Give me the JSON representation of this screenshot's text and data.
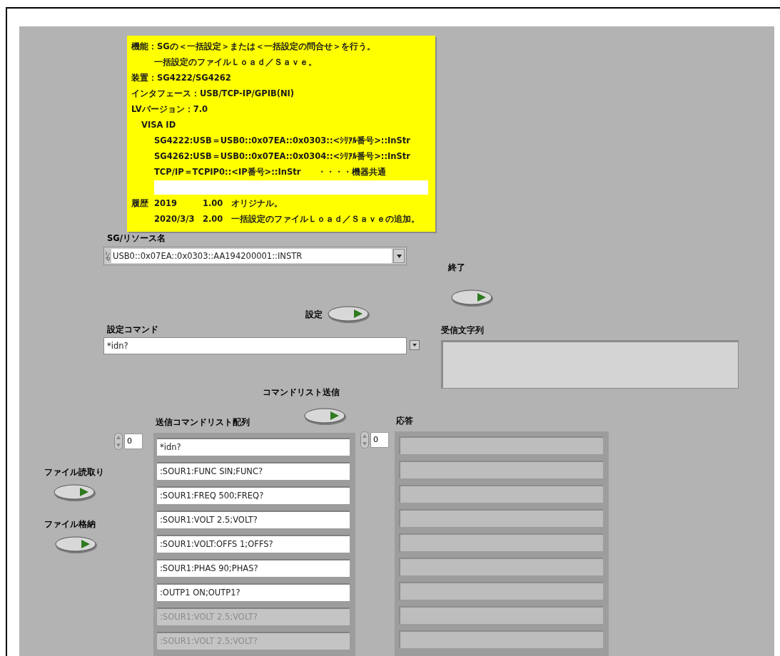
{
  "note": {
    "lines": [
      {
        "kind": "line",
        "text": "機能：SGの＜一括設定＞または＜一括設定の問合せ＞を行う。"
      },
      {
        "kind": "continuation",
        "text": "一括設定のファイルＬｏａｄ／Ｓａｖｅ。"
      },
      {
        "kind": "line",
        "text": "装置：SG4222/SG4262"
      },
      {
        "kind": "line",
        "text": "インタフェース：USB/TCP-IP/GPIB(NI)"
      },
      {
        "kind": "line",
        "text": "LVバージョン：7.0"
      },
      {
        "kind": "indent1",
        "text": "VISA ID"
      },
      {
        "kind": "indent2",
        "text": "SG4222:USB＝USB0::0x07EA::0x0303::<ｼﾘｱﾙ番号>::InStr"
      },
      {
        "kind": "indent2",
        "text": "SG4262:USB＝USB0::0x07EA::0x0304::<ｼﾘｱﾙ番号>::InStr"
      },
      {
        "kind": "indent2",
        "text": "TCP/IP＝TCPIP0::<IP番号>::InStr　　・・・・機器共通"
      },
      {
        "kind": "blank"
      }
    ],
    "history": [
      {
        "label": "履歴",
        "date": "2019",
        "version": "1.00",
        "note": "オリジナル。"
      },
      {
        "date": "2020/3/3",
        "version": "2.00",
        "note": "一括設定のファイルＬｏａｄ／Ｓａｖｅの追加。"
      }
    ]
  },
  "resource": {
    "label": "SG/リソース名",
    "value": "USB0::0x07EA::0x0303::AA194200001::INSTR"
  },
  "stop": {
    "label": "終了"
  },
  "set": {
    "label": "設定"
  },
  "command": {
    "label": "設定コマンド",
    "value": "*idn?"
  },
  "received": {
    "label": "受信文字列"
  },
  "send_list": {
    "label": "コマンドリスト送信"
  },
  "command_list": {
    "label": "送信コマンドリスト配列",
    "index": "0",
    "items": [
      {
        "text": "*idn?",
        "disabled": false
      },
      {
        "text": ":SOUR1:FUNC SIN;FUNC?",
        "disabled": false
      },
      {
        "text": ":SOUR1:FREQ 500;FREQ?",
        "disabled": false
      },
      {
        "text": ":SOUR1:VOLT 2.5;VOLT?",
        "disabled": false
      },
      {
        "text": ":SOUR1:VOLT:OFFS 1;OFFS?",
        "disabled": false
      },
      {
        "text": ":SOUR1:PHAS 90;PHAS?",
        "disabled": false
      },
      {
        "text": ":OUTP1 ON;OUTP1?",
        "disabled": false
      },
      {
        "text": ":SOUR1:VOLT 2.5;VOLT?",
        "disabled": true
      },
      {
        "text": ":SOUR1:VOLT 2.5;VOLT?",
        "disabled": true
      }
    ]
  },
  "response": {
    "label": "応答",
    "index": "0"
  },
  "file_read": {
    "label": "ファイル読取り"
  },
  "file_store": {
    "label": "ファイル格納"
  }
}
